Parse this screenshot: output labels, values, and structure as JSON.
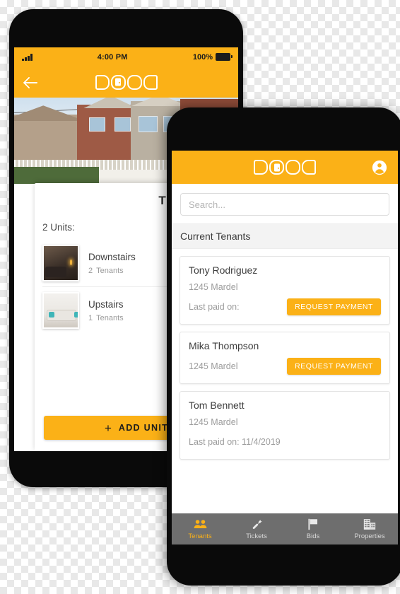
{
  "colors": {
    "brand": "#FBB117",
    "tabbar": "#6e6e6e",
    "active_tab": "#FBB117",
    "card_border": "#e4e4e4"
  },
  "left_phone": {
    "status_bar": {
      "signal": "signal-icon",
      "time": "4:00 PM",
      "battery_percent": "100%",
      "battery": "battery-full-icon"
    },
    "appbar": {
      "back": "back-arrow-icon",
      "logo": "DOOR"
    },
    "hero": {
      "alt": "property-photo"
    },
    "sheet": {
      "title": "The Duplex",
      "units_label": "2 Units:",
      "units": [
        {
          "thumb": "unit-photo-dark-living-room",
          "name": "Downstairs",
          "count": "2",
          "count_label": "Tenants"
        },
        {
          "thumb": "unit-photo-light-living-room",
          "name": "Upstairs",
          "count": "1",
          "count_label": "Tenants"
        }
      ],
      "add_button": {
        "plus": "+",
        "label": "ADD UNIT"
      }
    }
  },
  "right_phone": {
    "appbar": {
      "logo": "DOOR",
      "account": "account-circle-icon"
    },
    "search": {
      "placeholder": "Search...",
      "value": ""
    },
    "section_header": "Current Tenants",
    "tenants": [
      {
        "name": "Tony Rodriguez",
        "address": "1245 Mardel",
        "paid_label": "Last paid on:",
        "action": "REQUEST PAYMENT",
        "layout": "full"
      },
      {
        "name": "Mika Thompson",
        "address": "1245 Mardel",
        "paid_label": "",
        "action": "REQUEST PAYMENT",
        "layout": "compact"
      },
      {
        "name": "Tom Bennett",
        "address": "1245 Mardel",
        "paid_label": "Last paid on: 11/4/2019",
        "action": "",
        "layout": "nobutton"
      }
    ],
    "tabs": [
      {
        "icon": "people-icon",
        "label": "Tenants",
        "active": true
      },
      {
        "icon": "wrench-icon",
        "label": "Tickets",
        "active": false
      },
      {
        "icon": "flag-icon",
        "label": "Bids",
        "active": false
      },
      {
        "icon": "building-icon",
        "label": "Properties",
        "active": false
      }
    ]
  }
}
